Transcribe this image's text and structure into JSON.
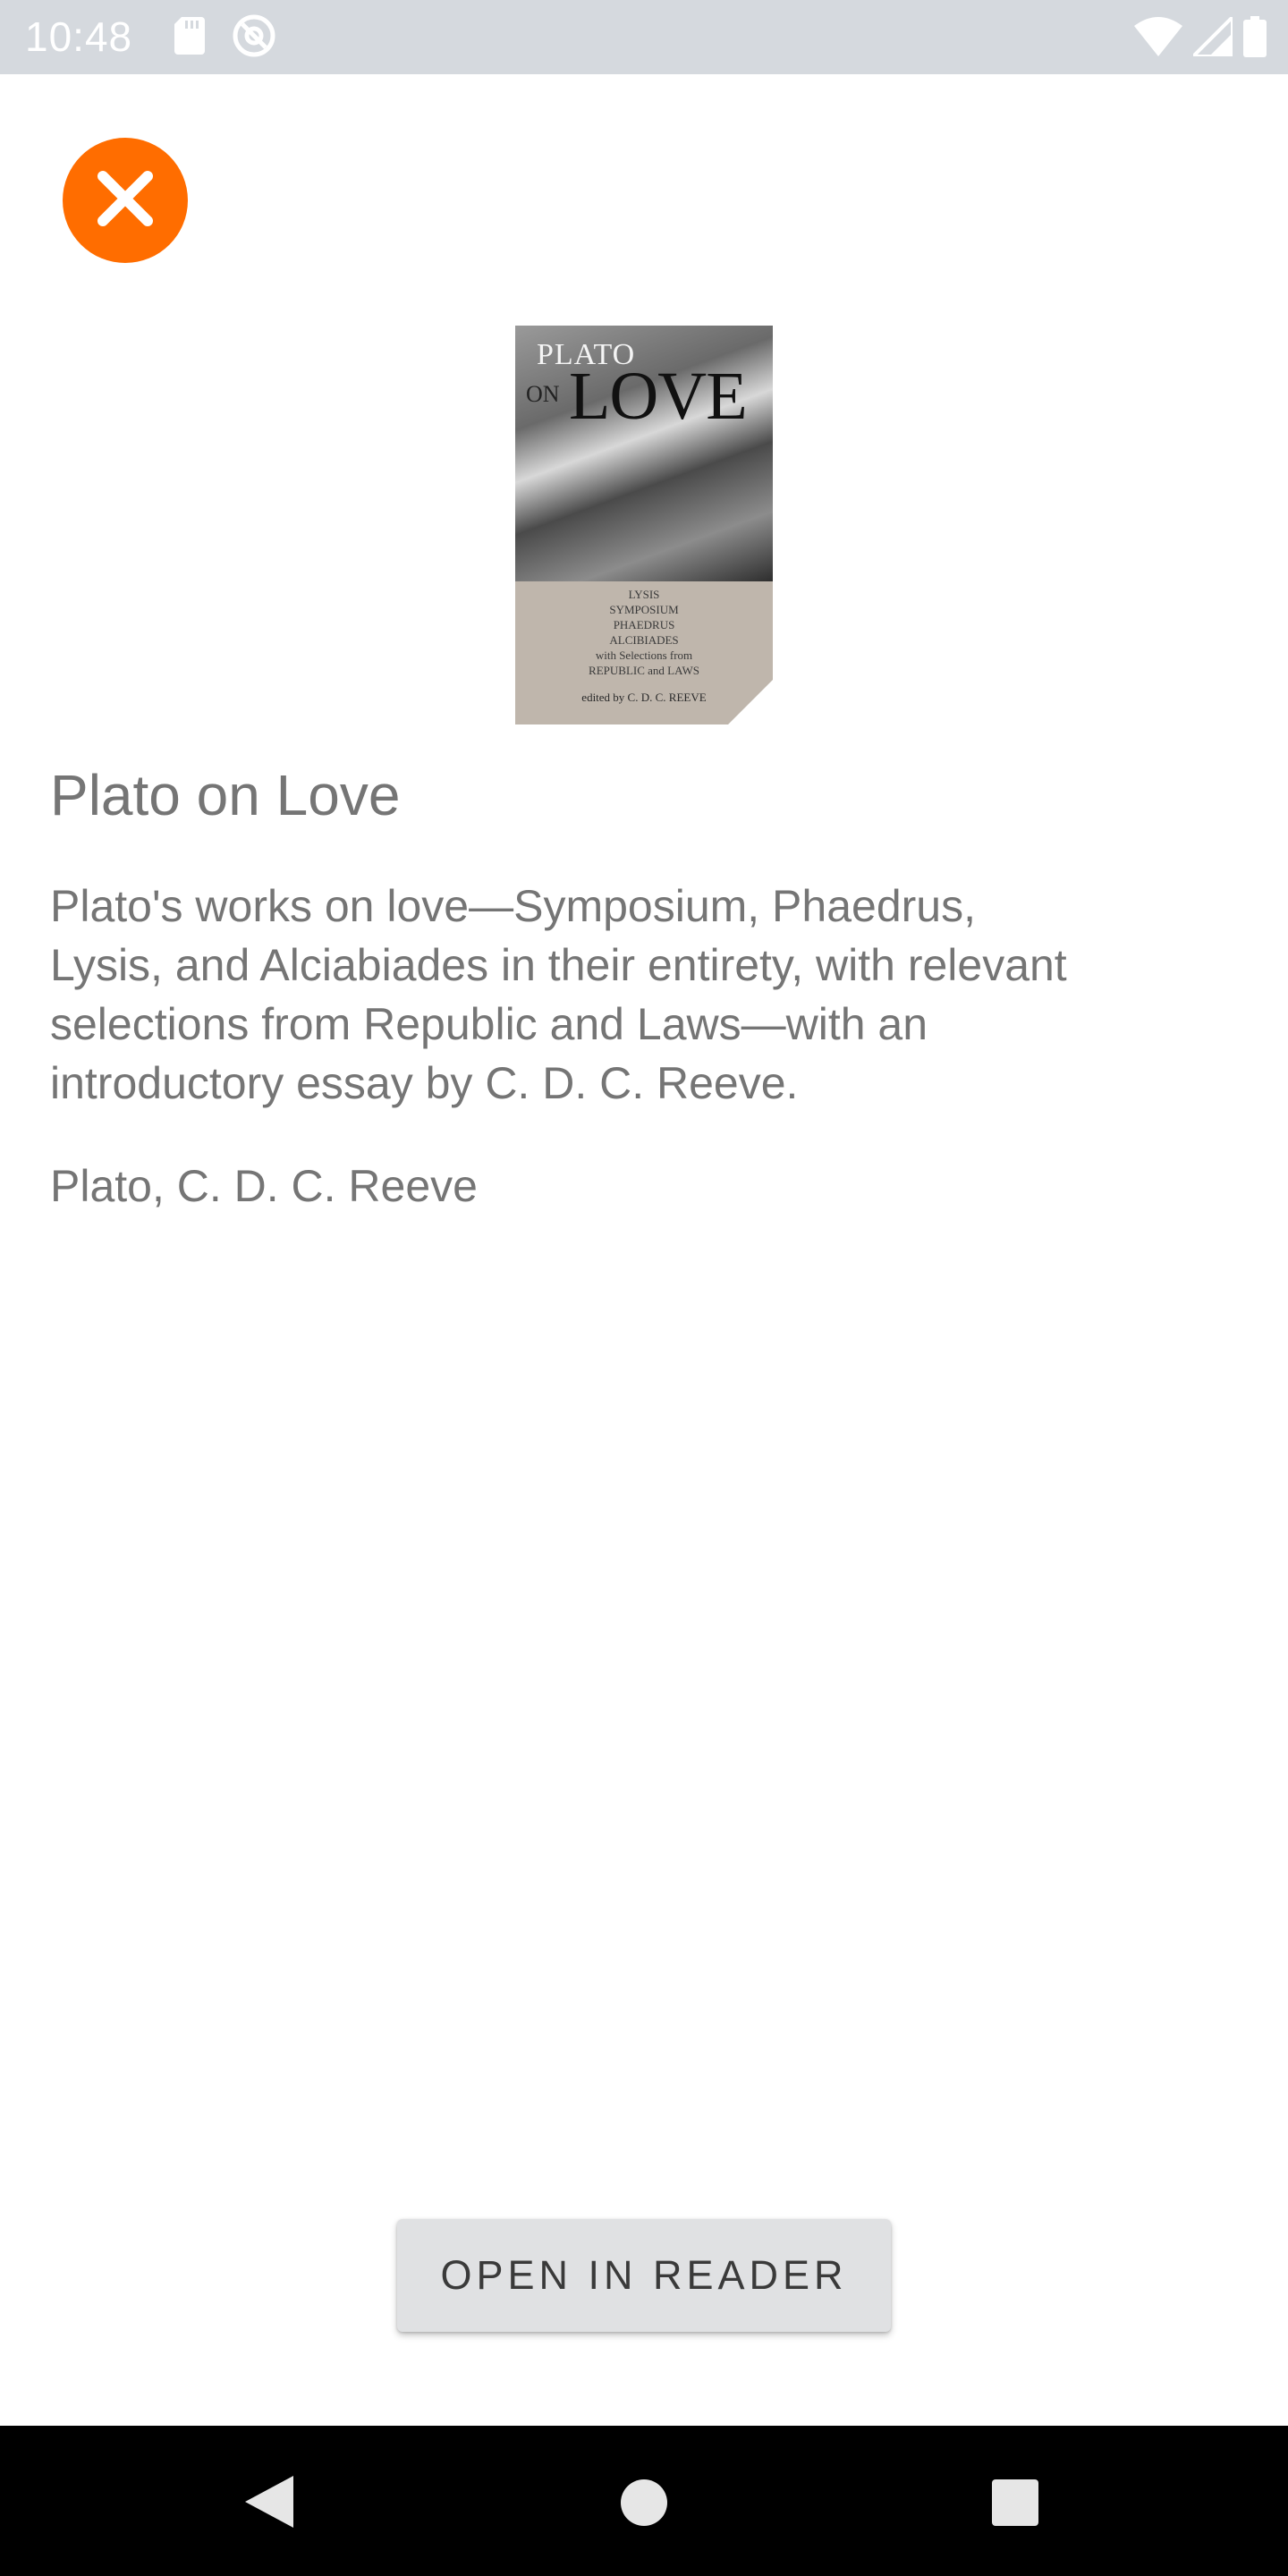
{
  "status_bar": {
    "time": "10:48",
    "left_icons": [
      "sd-card-icon",
      "at-sign-icon"
    ],
    "right_icons": [
      "wifi-icon",
      "signal-icon",
      "battery-icon"
    ]
  },
  "header": {
    "close_icon": "close-icon",
    "close_color": "#ff6d00"
  },
  "book": {
    "cover": {
      "title_top": "PLATO",
      "title_on": "ON",
      "title_big": "LOVE",
      "contents": [
        "LYSIS",
        "SYMPOSIUM",
        "PHAEDRUS",
        "ALCIBIADES",
        "with Selections from",
        "REPUBLIC and LAWS"
      ],
      "editor": "edited by C. D. C. REEVE"
    },
    "title": "Plato on Love",
    "description": "Plato's works on love—Symposium, Phaedrus,\nLysis, and Alciabiades in their entirety, with relevant\nselections from Republic and Laws—with an\nintroductory essay by C. D. C. Reeve.",
    "authors": "Plato, C. D. C. Reeve"
  },
  "actions": {
    "open_in_reader": "OPEN IN READER"
  },
  "nav_bar": {
    "back_icon": "back-triangle-icon",
    "home_icon": "home-circle-icon",
    "recents_icon": "recents-square-icon"
  }
}
